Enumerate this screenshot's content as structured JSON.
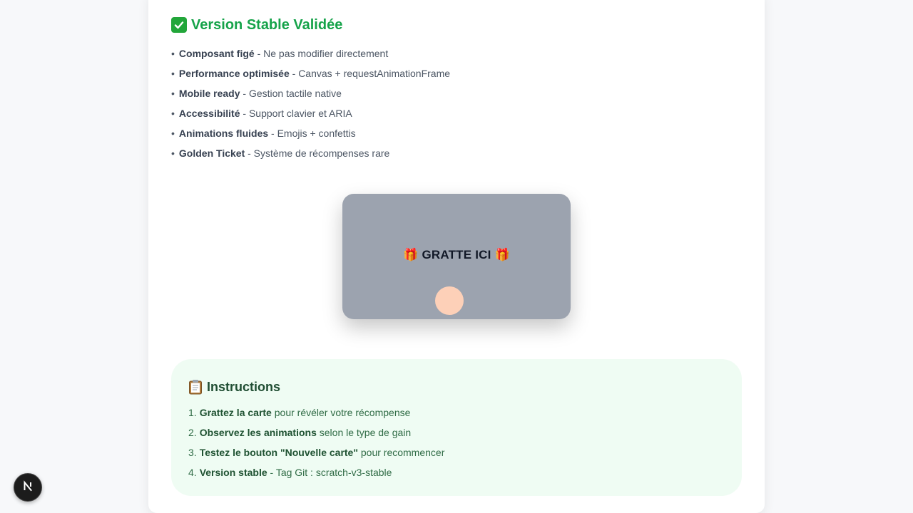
{
  "heading": {
    "icon": "check-mark-icon",
    "text": "Version Stable Validée"
  },
  "features": [
    {
      "name": "Composant figé",
      "desc": " - Ne pas modifier directement"
    },
    {
      "name": "Performance optimisée",
      "desc": " - Canvas + requestAnimationFrame"
    },
    {
      "name": "Mobile ready",
      "desc": " - Gestion tactile native"
    },
    {
      "name": "Accessibilité",
      "desc": " - Support clavier et ARIA"
    },
    {
      "name": "Animations fluides",
      "desc": " - Emojis + confettis"
    },
    {
      "name": "Golden Ticket",
      "desc": " - Système de récompenses rare"
    }
  ],
  "bullet": "•",
  "card": {
    "label": "GRATTE ICI",
    "gift_icon": "🎁"
  },
  "instructions": {
    "icon": "clipboard-icon",
    "title": "Instructions",
    "steps": [
      {
        "num": "1.",
        "bold": "Grattez la carte",
        "rest": " pour révéler votre récompense"
      },
      {
        "num": "2.",
        "bold": "Observez les animations",
        "rest": " selon le type de gain"
      },
      {
        "num": "3.",
        "bold": "Testez le bouton \"Nouvelle carte\"",
        "rest": " pour recommencer"
      },
      {
        "num": "4.",
        "bold": "Version stable",
        "rest": " - Tag Git : scratch-v3-stable"
      }
    ]
  },
  "fab": {
    "letter": "N",
    "icon": "nextjs-logo-icon"
  },
  "colors": {
    "accent_green": "#16a34a",
    "card_gray": "#9ca3af",
    "instructions_bg": "#effcf3"
  }
}
